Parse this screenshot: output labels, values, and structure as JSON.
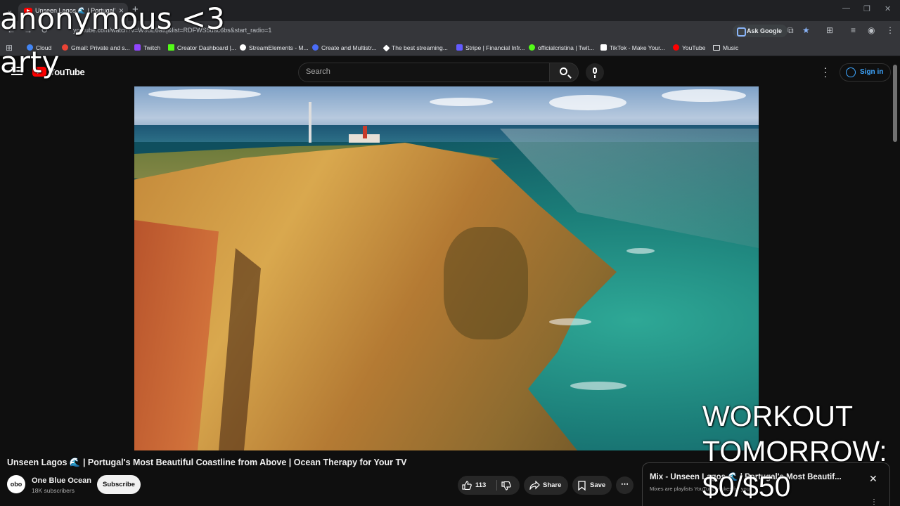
{
  "browser": {
    "tab_title": "Unseen Lagos 🌊 | Portugal's M",
    "new_tab": "+",
    "address": "youtube.com/watch?v=W9dE6atq&list=RDFWS5uac6bs&start_radio=1",
    "ask_google": "Ask Google",
    "window_controls": [
      "—",
      "❐",
      "✕"
    ]
  },
  "bookmarks": [
    {
      "label": "Cloud",
      "color": "#4285f4"
    },
    {
      "label": "Gmail: Private and s...",
      "color": "#ea4335"
    },
    {
      "label": "Twitch",
      "color": "#9146ff"
    },
    {
      "label": "Creator Dashboard |...",
      "color": "#53fc18"
    },
    {
      "label": "StreamElements - M...",
      "color": "#ffffff"
    },
    {
      "label": "Create and Multistr...",
      "color": "#4a6cf7"
    },
    {
      "label": "The best streaming...",
      "color": "#ffffff"
    },
    {
      "label": "Stripe | Financial Infr...",
      "color": "#635bff"
    },
    {
      "label": "officialcristina | Twit...",
      "color": "#53fc18"
    },
    {
      "label": "TikTok - Make Your...",
      "color": "#ffffff"
    },
    {
      "label": "YouTube",
      "color": "#ff0000"
    },
    {
      "label": "Music",
      "color": "#e8eaed"
    }
  ],
  "youtube": {
    "logo": "YouTube",
    "search_placeholder": "Search",
    "sign_in": "Sign in"
  },
  "overlays": {
    "top_left_1": "anonymous <3",
    "top_left_2": "arty",
    "goal_1": "WORKOUT",
    "goal_2": "TOMORROW:",
    "goal_3": "$0/$50"
  },
  "video": {
    "title": "Unseen Lagos 🌊 | Portugal's Most Beautiful Coastline from Above | Ocean Therapy for Your TV",
    "channel_name": "One Blue Ocean",
    "channel_avatar": "obo",
    "subscribers": "18K subscribers",
    "subscribe": "Subscribe",
    "likes": "113",
    "share": "Share",
    "save": "Save",
    "more": "⋯"
  },
  "mix": {
    "title": "Mix - Unseen Lagos 🌊 | Portugal's Most Beautif...",
    "subtitle": "Mixes are playlists YouTube makes for you",
    "close": "✕",
    "menu": "⋮"
  }
}
